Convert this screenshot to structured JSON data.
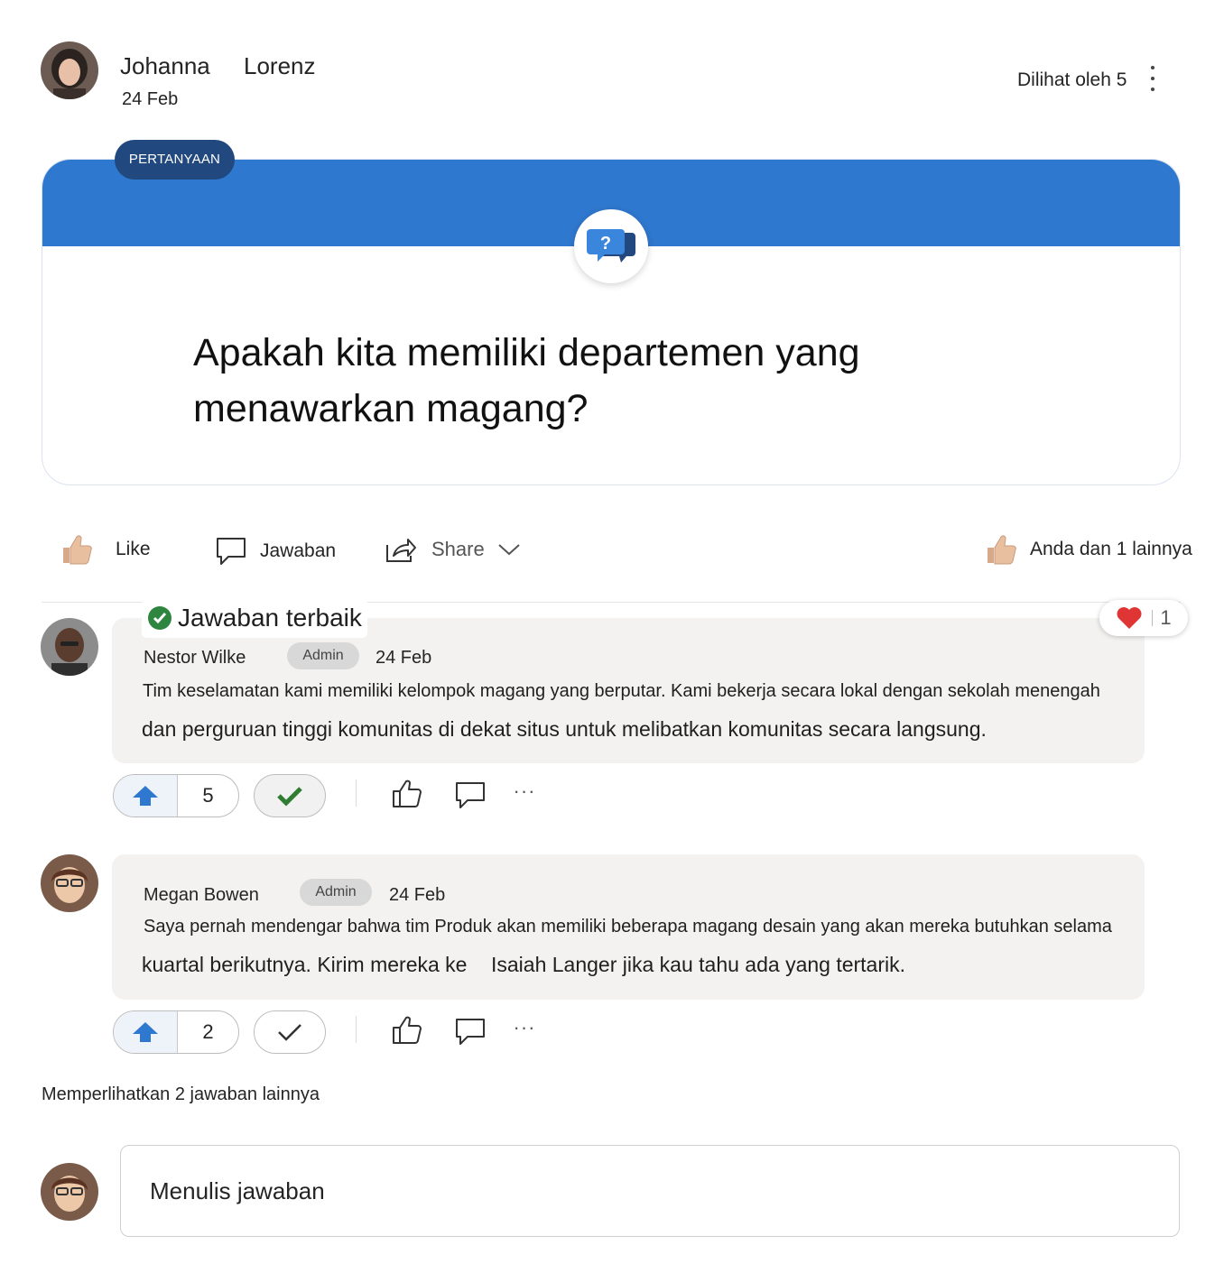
{
  "post": {
    "author_first": "Johanna",
    "author_last": "Lorenz",
    "date": "24 Feb",
    "seen_by": "Dilihat oleh 5",
    "more_icon": "more-vertical-icon"
  },
  "question": {
    "badge": "PERTANYAAN",
    "line1": "Apakah kita memiliki departemen yang",
    "line2": "menawarkan magang?",
    "band_color": "#2F78CF",
    "badge_color": "#21497F"
  },
  "actions": {
    "like": "Like",
    "reply": "Jawaban",
    "share": "Share",
    "reactions_summary": "Anda dan 1 lainnya"
  },
  "replies": [
    {
      "best_answer_label": "Jawaban terbaik",
      "name": "Nestor Wilke",
      "badge": "Admin",
      "date": "24 Feb",
      "line1": "Tim keselamatan kami memiliki kelompok magang yang berputar. Kami bekerja secara lokal dengan sekolah menengah",
      "line2": "dan perguruan tinggi komunitas di dekat situs untuk melibatkan komunitas secara langsung.",
      "reaction_count": "1",
      "votes": "5",
      "accepted": true
    },
    {
      "name": "Megan Bowen",
      "badge": "Admin",
      "date": "24 Feb",
      "line1": "Saya pernah mendengar bahwa tim Produk akan memiliki beberapa magang desain yang akan mereka butuhkan selama",
      "line2a": "kuartal berikutnya. Kirim mereka ke",
      "line2b": "Isaiah Langer jika kau tahu ada yang tertarik.",
      "votes": "2",
      "accepted": false
    }
  ],
  "more_replies": "Memperlihatkan 2 jawaban lainnya",
  "compose": {
    "placeholder": "Menulis jawaban"
  },
  "colors": {
    "accent": "#2F78CF",
    "upvote": "#2F78CF",
    "check": "#2E7D32",
    "heart": "#E03535"
  }
}
